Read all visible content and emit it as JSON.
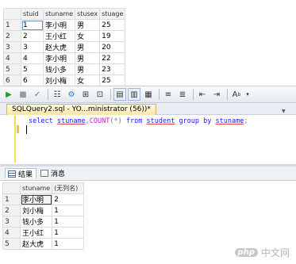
{
  "top_grid": {
    "columns": [
      "stuid",
      "stuname",
      "stusex",
      "stuage"
    ],
    "rows": [
      {
        "n": "1",
        "cells": [
          "1",
          "李小明",
          "男",
          "25"
        ]
      },
      {
        "n": "2",
        "cells": [
          "2",
          "王小红",
          "女",
          "19"
        ]
      },
      {
        "n": "3",
        "cells": [
          "3",
          "赵大虎",
          "男",
          "20"
        ]
      },
      {
        "n": "4",
        "cells": [
          "4",
          "李小明",
          "男",
          "22"
        ]
      },
      {
        "n": "5",
        "cells": [
          "5",
          "钱小多",
          "男",
          "23"
        ]
      },
      {
        "n": "6",
        "cells": [
          "6",
          "刘小梅",
          "女",
          "25"
        ]
      }
    ]
  },
  "toolbar": {
    "icons": [
      "execute-icon",
      "stop-icon",
      "parse-check-icon",
      "debug-icon",
      "results-to-grid-icon",
      "comment-icon",
      "uncomment-icon",
      "indent-icon",
      "outdent-icon",
      "specify-values-icon"
    ]
  },
  "editor": {
    "tab_title": "SQLQuery2.sql - YO...ministrator (56))*",
    "query": {
      "select": "select",
      "col1": "stuname",
      "comma": ",",
      "fn": "COUNT",
      "args": "(*)",
      "from": "from",
      "table": "student",
      "group_by": "group by",
      "col2": "stuname",
      "end": ";"
    }
  },
  "results": {
    "tabs": {
      "results": "结果",
      "messages": "消息"
    },
    "columns": [
      "stuname",
      "(无列名)"
    ],
    "rows": [
      {
        "n": "1",
        "cells": [
          "李小明",
          "2"
        ]
      },
      {
        "n": "2",
        "cells": [
          "刘小梅",
          "1"
        ]
      },
      {
        "n": "3",
        "cells": [
          "钱小多",
          "1"
        ]
      },
      {
        "n": "4",
        "cells": [
          "王小红",
          "1"
        ]
      },
      {
        "n": "5",
        "cells": [
          "赵大虎",
          "1"
        ]
      }
    ]
  },
  "watermark": {
    "logo": "php",
    "text": "中文网"
  }
}
